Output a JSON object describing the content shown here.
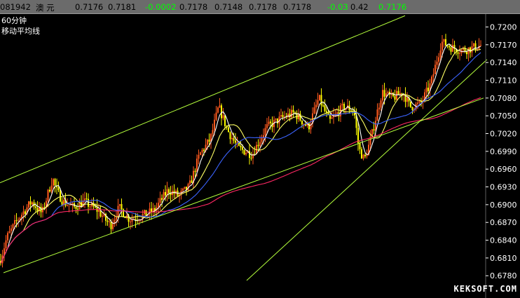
{
  "quote_bar": {
    "code": "081942",
    "name": "澳  元",
    "open": "0.7176",
    "high": "0.7181",
    "change": "-0.0002",
    "price": "0.7178",
    "low": "0.7148",
    "bid": "0.7178",
    "ask": "0.7178",
    "change_pct": "-0.03",
    "volume": "0.42",
    "last": "0.7176"
  },
  "indicator": {
    "period": "60分钟",
    "name": "移动平均线"
  },
  "watermark": "KEKSOFT.COM",
  "colors": {
    "background": "#000000",
    "up_candle": "#ff5a1e",
    "down_candle": "#ffff00",
    "ma_short": "#ffffff",
    "ma_medium": "#ffff64",
    "ma_blue": "#3c64ff",
    "ma_long": "#ff2864",
    "trendline": "#b4ff3c",
    "axis_text": "#ffffff",
    "positive": "#00ff00"
  },
  "chart_data": {
    "type": "candlestick",
    "y_axis_ticks": [
      "0.7200",
      "0.7170",
      "0.7140",
      "0.7110",
      "0.7080",
      "0.7050",
      "0.7020",
      "0.6990",
      "0.6960",
      "0.6930",
      "0.6900",
      "0.6870",
      "0.6840",
      "0.6810",
      "0.6780"
    ],
    "ylim": [
      0.6772,
      0.721
    ],
    "close_path": [
      [
        0,
        0.6805
      ],
      [
        10,
        0.6845
      ],
      [
        25,
        0.6875
      ],
      [
        45,
        0.6905
      ],
      [
        60,
        0.6885
      ],
      [
        75,
        0.6945
      ],
      [
        80,
        0.6925
      ],
      [
        90,
        0.6905
      ],
      [
        105,
        0.6895
      ],
      [
        120,
        0.6905
      ],
      [
        140,
        0.689
      ],
      [
        150,
        0.6875
      ],
      [
        158,
        0.6865
      ],
      [
        170,
        0.6895
      ],
      [
        185,
        0.6875
      ],
      [
        200,
        0.688
      ],
      [
        220,
        0.689
      ],
      [
        240,
        0.6925
      ],
      [
        255,
        0.6915
      ],
      [
        270,
        0.693
      ],
      [
        285,
        0.6985
      ],
      [
        300,
        0.701
      ],
      [
        312,
        0.7065
      ],
      [
        325,
        0.7025
      ],
      [
        340,
        0.6995
      ],
      [
        360,
        0.6985
      ],
      [
        380,
        0.703
      ],
      [
        400,
        0.7045
      ],
      [
        420,
        0.7055
      ],
      [
        440,
        0.703
      ],
      [
        455,
        0.708
      ],
      [
        470,
        0.704
      ],
      [
        490,
        0.7065
      ],
      [
        505,
        0.706
      ],
      [
        512,
        0.6995
      ],
      [
        520,
        0.6975
      ],
      [
        530,
        0.7015
      ],
      [
        545,
        0.709
      ],
      [
        560,
        0.708
      ],
      [
        575,
        0.709
      ],
      [
        585,
        0.7065
      ],
      [
        600,
        0.707
      ],
      [
        615,
        0.7105
      ],
      [
        630,
        0.7175
      ],
      [
        645,
        0.7165
      ],
      [
        660,
        0.716
      ],
      [
        675,
        0.7165
      ],
      [
        688,
        0.717
      ]
    ],
    "moving_averages": [
      {
        "name": "MA5",
        "color_key": "ma_short",
        "window": 5
      },
      {
        "name": "MA10",
        "color_key": "ma_medium",
        "window": 14
      },
      {
        "name": "MA20",
        "color_key": "ma_blue",
        "window": 30
      },
      {
        "name": "MA60",
        "color_key": "ma_long",
        "window": 120
      }
    ],
    "trendlines": [
      {
        "name": "channel-upper",
        "from": [
          0,
          0.6937
        ],
        "to": [
          578,
          0.7219
        ]
      },
      {
        "name": "channel-lower",
        "from": [
          5,
          0.6785
        ],
        "to": [
          690,
          0.708
        ]
      },
      {
        "name": "steep-support",
        "from": [
          352,
          0.6772
        ],
        "to": [
          695,
          0.7145
        ]
      }
    ]
  }
}
